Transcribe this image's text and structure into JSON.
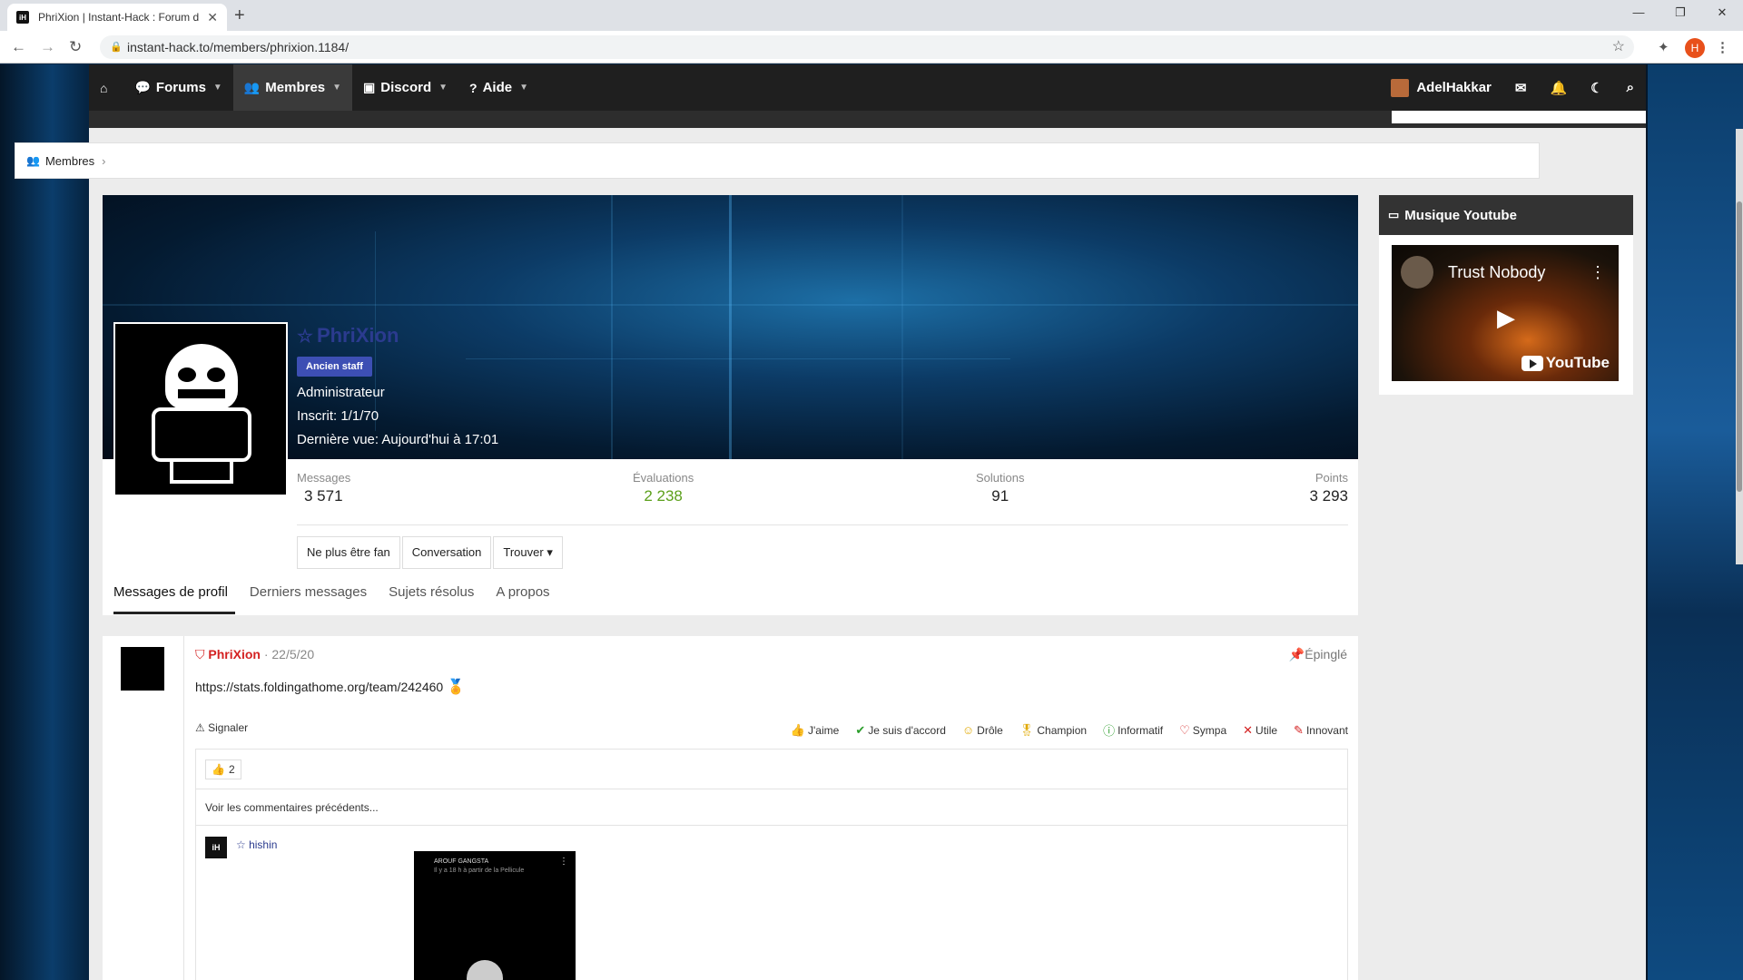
{
  "browser": {
    "tab_title": "PhriXion | Instant-Hack : Forum d",
    "url": "instant-hack.to/members/phrixion.1184/",
    "profile_initial": "H"
  },
  "nav": {
    "forums": "Forums",
    "membres": "Membres",
    "discord": "Discord",
    "aide": "Aide",
    "username": "AdelHakkar"
  },
  "breadcrumb": {
    "item": "Membres"
  },
  "profile": {
    "name": "PhriXion",
    "badge": "Ancien staff",
    "role": "Administrateur",
    "joined": "Inscrit: 1/1/70",
    "last_seen": "Dernière vue: Aujourd'hui à 17:01",
    "stats": [
      {
        "label": "Messages",
        "value": "3 571"
      },
      {
        "label": "Évaluations",
        "value": "2 238"
      },
      {
        "label": "Solutions",
        "value": "91"
      },
      {
        "label": "Points",
        "value": "3 293"
      }
    ],
    "buttons": {
      "unfollow": "Ne plus être fan",
      "conversation": "Conversation",
      "find": "Trouver"
    },
    "tabs": [
      "Messages de profil",
      "Derniers messages",
      "Sujets résolus",
      "A propos"
    ]
  },
  "widget": {
    "title": "Musique Youtube",
    "video_title": "Trust Nobody",
    "logo": "YouTube"
  },
  "post": {
    "author": "PhriXion",
    "date": "· 22/5/20",
    "pinned": "Épinglé",
    "text": "https://stats.foldingathome.org/team/242460",
    "report": "Signaler",
    "reactions": [
      "J'aime",
      "Je suis d'accord",
      "Drôle",
      "Champion",
      "Informatif",
      "Sympa",
      "Utile",
      "Innovant"
    ],
    "like_count": "2",
    "prev_comments": "Voir les commentaires précédents...",
    "commenter": "hishin",
    "video_channel": "AROUF GANGSTA",
    "video_sub": "Il y a 18 h à partir de la Pellicule"
  },
  "colors": {
    "accent": "#3d4fb4",
    "author_red": "#d42222",
    "green": "#5ca01b"
  }
}
